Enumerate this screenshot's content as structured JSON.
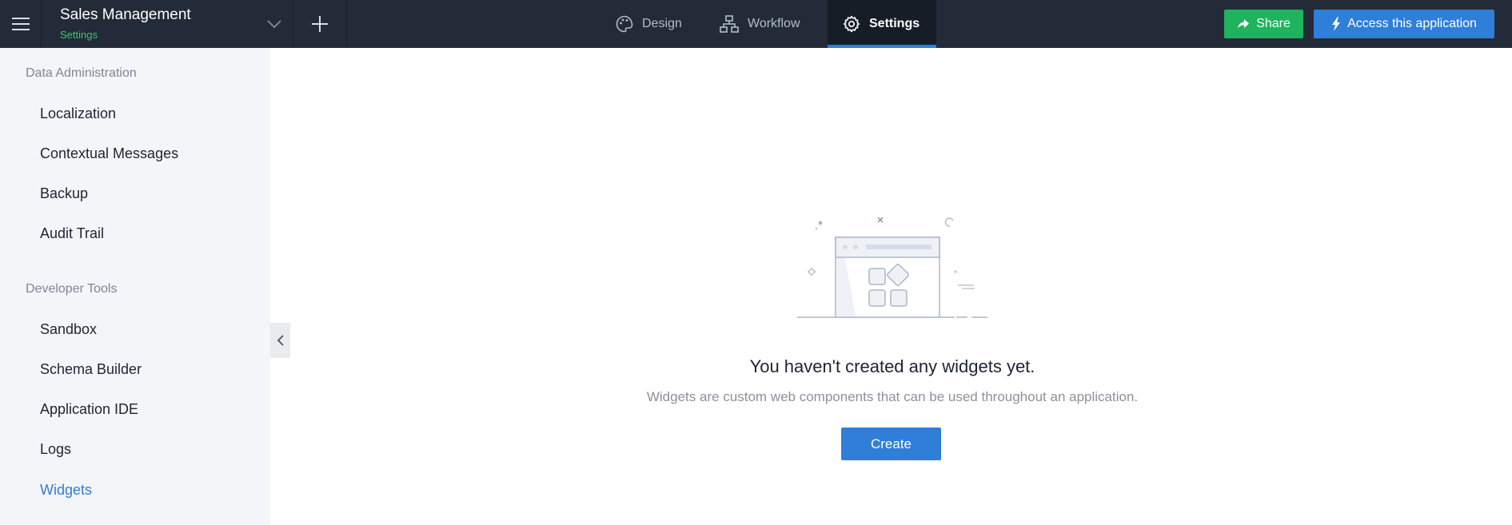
{
  "header": {
    "app_name": "Sales Management",
    "app_subtitle": "Settings",
    "tabs": [
      {
        "label": "Design",
        "icon": "palette-icon"
      },
      {
        "label": "Workflow",
        "icon": "workflow-icon"
      },
      {
        "label": "Settings",
        "icon": "gear-icon",
        "active": true
      }
    ],
    "share_label": "Share",
    "access_label": "Access this application"
  },
  "sidebar": {
    "sections": [
      {
        "title": "Data Administration",
        "items": [
          "Localization",
          "Contextual Messages",
          "Backup",
          "Audit Trail"
        ]
      },
      {
        "title": "Developer Tools",
        "items": [
          "Sandbox",
          "Schema Builder",
          "Application IDE",
          "Logs",
          "Widgets"
        ]
      }
    ],
    "active_item": "Widgets"
  },
  "empty_state": {
    "title": "You haven't created any widgets yet.",
    "description": "Widgets are custom web components that can be used throughout an application.",
    "create_label": "Create"
  },
  "colors": {
    "topbar_bg": "#232b38",
    "accent_blue": "#2f7ed8",
    "share_green": "#1fb35d",
    "subtitle_green": "#2ecc71",
    "sidebar_bg": "#f4f5f8"
  }
}
